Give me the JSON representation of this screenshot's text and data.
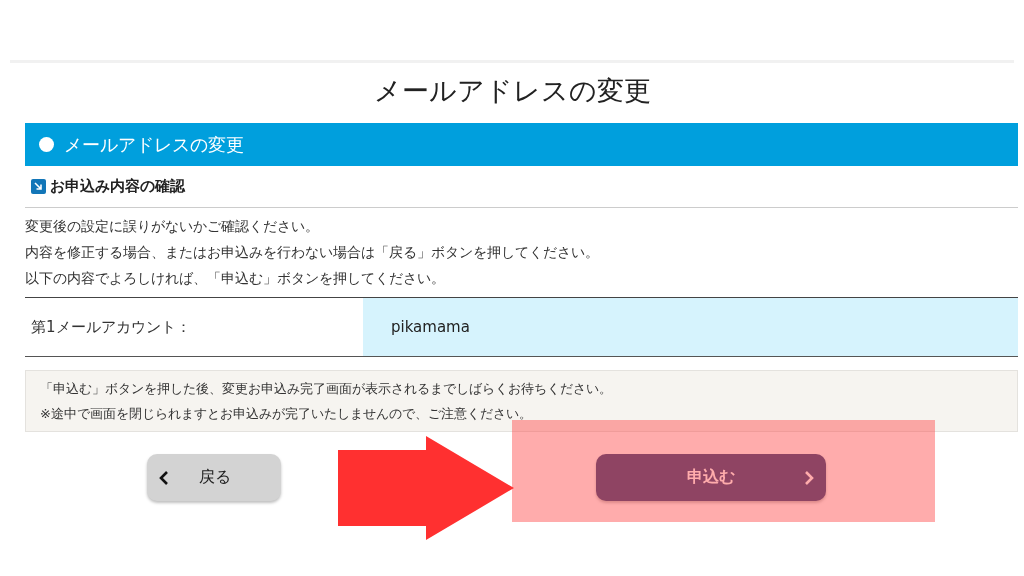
{
  "page_title": "メールアドレスの変更",
  "section": {
    "title": "メールアドレスの変更"
  },
  "subsection": {
    "title": "お申込み内容の確認"
  },
  "instructions": [
    "変更後の設定に誤りがないかご確認ください。",
    "内容を修正する場合、またはお申込みを行わない場合は「戻る」ボタンを押してください。",
    "以下の内容でよろしければ、「申込む」ボタンを押してください。"
  ],
  "fields": [
    {
      "label": "第1メールアカウント：",
      "value": "pikamama"
    }
  ],
  "notes": [
    "「申込む」ボタンを押した後、変更お申込み完了画面が表示されるまでしばらくお待ちください。",
    "※途中で画面を閉じられますとお申込みが完了いたしませんので、ご注意ください。"
  ],
  "buttons": [
    {
      "kind": "back",
      "label": "戻る"
    },
    {
      "kind": "submit",
      "label": "申込む"
    }
  ]
}
